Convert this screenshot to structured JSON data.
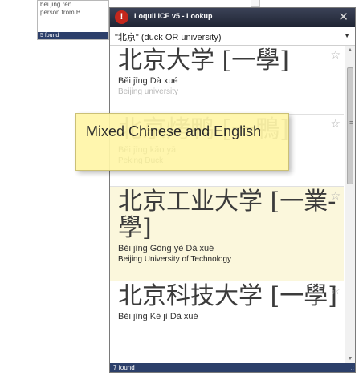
{
  "background_window": {
    "lines": [
      "bei jing rén",
      "person from B"
    ],
    "status": "5 found"
  },
  "window": {
    "title": "Loquil ICE v5 - Lookup",
    "icon_glyph": "!",
    "close_glyph": "✕"
  },
  "search": {
    "query": "\"北京\" (duck OR university)",
    "dropdown_glyph": "▼"
  },
  "results": [
    {
      "hanzi": "北京大学 [一學]",
      "pinyin": "Běi jīng Dà xué",
      "english": "Beijing university",
      "english_faded": true,
      "highlighted": false
    },
    {
      "hanzi": "北京烤鸭 [一鴨]",
      "pinyin": "Běi jīng kǎo yā",
      "english": "Peking Duck",
      "english_faded": false,
      "highlighted": false
    },
    {
      "hanzi": "北京工业大学 [一業-學]",
      "pinyin": "Běi jīng Gōng yè Dà xué",
      "english": "Beijing University of Technology",
      "english_faded": false,
      "highlighted": true
    },
    {
      "hanzi": "北京科技大学 [一學]",
      "pinyin": "Běi jīng Kē jì Dà xué",
      "english": "",
      "english_faded": false,
      "highlighted": false
    }
  ],
  "star_glyph": "☆",
  "scrollbar": {
    "up_glyph": "▲",
    "down_glyph": "▼",
    "grip_glyph": "≡"
  },
  "status": "7 found",
  "resize_glyph": ".:",
  "callout": {
    "text": "Mixed Chinese and English"
  },
  "colors": {
    "titlebar": "#262b3b",
    "status_bar": "#2c3f6a",
    "highlight": "#fbf7dc",
    "callout": "#fff6a8",
    "app_icon": "#c4271c"
  }
}
